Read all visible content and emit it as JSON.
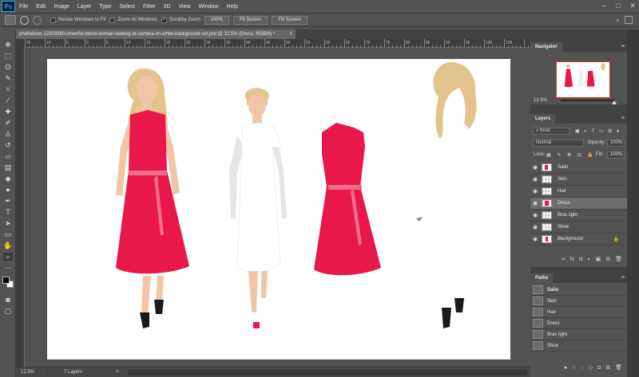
{
  "app": {
    "logo": "Ps"
  },
  "menu": [
    "File",
    "Edit",
    "Image",
    "Layer",
    "Type",
    "Select",
    "Filter",
    "3D",
    "View",
    "Window",
    "Help"
  ],
  "window_controls": {
    "minimize": "–",
    "maximize": "□",
    "close": "✕"
  },
  "options": {
    "resize_windows_label": "Resize Windows to Fit",
    "zoom_all_label": "Zoom All Windows",
    "scrubby_zoom_label": "Scrubby Zoom",
    "btn_100": "100%",
    "btn_fit": "Fit Screen",
    "btn_fill": "Fill Screen"
  },
  "document": {
    "tab_title": "photodune-12303380-cheerful-blond-woman-looking-at-camera-on-white-background-xxl.psd @ 12.5% (Dress, RGB/8) *",
    "close": "×"
  },
  "ruler": {
    "h_ticks": [
      "25",
      "10",
      "5",
      "0",
      "5",
      "10",
      "15",
      "20",
      "25",
      "30",
      "35",
      "40",
      "45",
      "50",
      "55",
      "60",
      "65",
      "70",
      "75",
      "80",
      "85",
      "90",
      "95",
      "100",
      "105"
    ]
  },
  "status": {
    "zoom": "12.5%",
    "info": "7 Layers",
    "arrow": ">"
  },
  "navigator": {
    "tab": "Navigator",
    "zoom": "12.5%"
  },
  "layers": {
    "tab": "Layers",
    "kind": "Kind",
    "blend": "Normal",
    "opacity_label": "Opacity:",
    "opacity": "100%",
    "lock_label": "Lock:",
    "fill_label": "Fill:",
    "fill": "100%",
    "items": [
      {
        "name": "Sailo"
      },
      {
        "name": "Skin"
      },
      {
        "name": "Hair"
      },
      {
        "name": "Dress"
      },
      {
        "name": "Bras light"
      },
      {
        "name": "Shoe"
      },
      {
        "name": "Background"
      }
    ],
    "footer": [
      "∞",
      "fx",
      "◘",
      "◐",
      "▣",
      "⊞",
      "🗑"
    ]
  },
  "paths": {
    "tab": "Paths",
    "items": [
      {
        "name": "Sailo"
      },
      {
        "name": "Skin"
      },
      {
        "name": "Hair"
      },
      {
        "name": "Dress"
      },
      {
        "name": "Bras light"
      },
      {
        "name": "Shoe"
      }
    ]
  },
  "colors": {
    "dress": "#e8184a",
    "skin": "#f1c6a6",
    "hair": "#e3c48c",
    "shoe": "#1a1a1a",
    "canvas": "#ffffff",
    "chrome": "#535353"
  }
}
